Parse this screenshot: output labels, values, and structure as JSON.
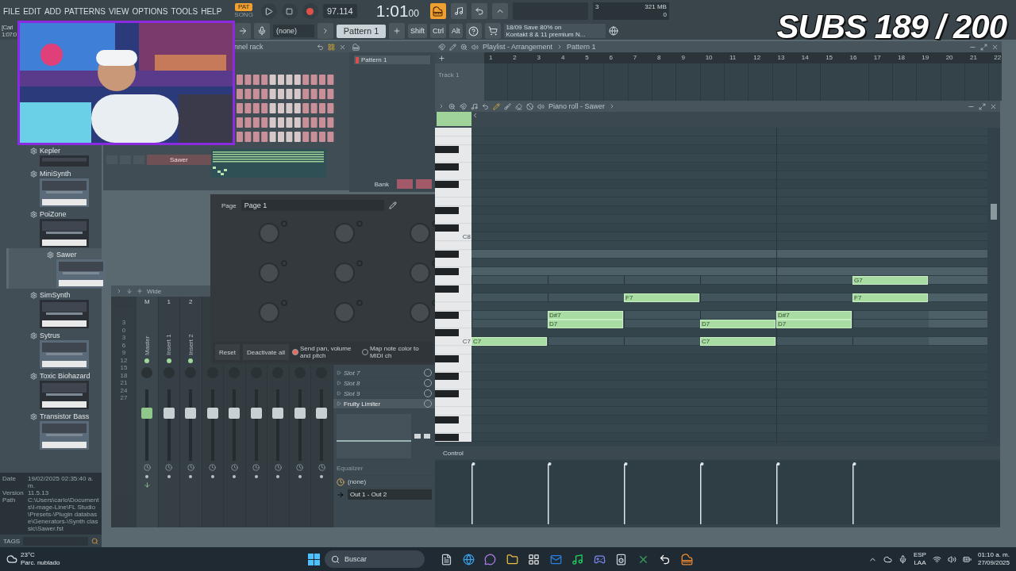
{
  "menu": [
    "FILE",
    "EDIT",
    "ADD",
    "PATTERNS",
    "VIEW",
    "OPTIONS",
    "TOOLS",
    "HELP"
  ],
  "transport": {
    "modes": [
      {
        "label": "PAT",
        "selected": true
      },
      {
        "label": "SONG",
        "selected": false
      }
    ],
    "tempo": "97.114",
    "time": "1:01",
    "time_small": "00"
  },
  "monitor": {
    "cpu": "3",
    "memory": "321 MB",
    "polyphony": "0"
  },
  "overlay": {
    "subs": "SUBS 189 / 200"
  },
  "hint_left": {
    "line1": "[Carl",
    "line2": "1:07:0"
  },
  "toolbar": {
    "snap": "(none)",
    "pattern": "Pattern 1",
    "modifiers": [
      "Shift",
      "Ctrl",
      "Alt"
    ],
    "news_date": "18/09",
    "news_line1": "Save 80% on",
    "news_line2": "Kontakt 8 & 11 premium N..."
  },
  "browser": {
    "items": [
      {
        "name": "Kepler",
        "selected": false
      },
      {
        "name": "MiniSynth",
        "selected": false
      },
      {
        "name": "PoiZone",
        "selected": false
      },
      {
        "name": "Sawer",
        "selected": true
      },
      {
        "name": "SimSynth",
        "selected": false
      },
      {
        "name": "Sytrus",
        "selected": false
      },
      {
        "name": "Toxic Biohazard",
        "selected": false
      },
      {
        "name": "Transistor Bass",
        "selected": false
      }
    ],
    "info": [
      {
        "label": "Date",
        "value": "19/02/2025 02:35:40 a. m."
      },
      {
        "label": "Version",
        "value": "11.5.13"
      },
      {
        "label": "Path",
        "value": "C:\\Users\\carlo\\Documents\\I-mage-Line\\FL Studio\\Presets-\\Plugin database\\Generators-\\Synth classic\\Sawer.fst"
      }
    ],
    "tags": "TAGS"
  },
  "channel_rack": {
    "title": "nnel rack",
    "channel": "Sawer"
  },
  "pattern_picker": {
    "patterns": [
      "Pattern 1"
    ],
    "bank": "Bank"
  },
  "controller": {
    "page_label": "Page",
    "page": "Page 1",
    "buttons": [
      "Reset",
      "Deactivate all"
    ],
    "options": [
      {
        "label": "Send pan, volume and pitch",
        "checked": true
      },
      {
        "label": "Map note color to MIDI ch",
        "checked": false
      }
    ]
  },
  "mixer": {
    "toolbar_label": "Wide",
    "meter_scale": [
      "3",
      "0",
      "3",
      "6",
      "9",
      "12",
      "15",
      "18",
      "21",
      "24",
      "27"
    ],
    "strips": [
      {
        "kind": "master",
        "header": "M",
        "label": "Master",
        "level": 0.7
      },
      {
        "kind": "insert",
        "header": "1",
        "label": "Insert 1",
        "level": 0.7
      },
      {
        "kind": "insert",
        "header": "2",
        "label": "Insert 2",
        "level": 0.7
      },
      {
        "kind": "insert",
        "level": 0.7
      },
      {
        "kind": "insert",
        "level": 0.7
      },
      {
        "kind": "insert",
        "level": 0.7
      },
      {
        "kind": "insert",
        "level": 0.7
      },
      {
        "kind": "insert",
        "level": 0.7
      },
      {
        "kind": "insert",
        "level": 0.7
      }
    ]
  },
  "mixer_slots": {
    "slots": [
      {
        "name": "Slot 7",
        "active": false
      },
      {
        "name": "Slot 8",
        "active": false
      },
      {
        "name": "Slot 9",
        "active": false
      },
      {
        "name": "Fruity Limiter",
        "active": true
      }
    ],
    "eq_label": "Equalizer",
    "input": "(none)",
    "output": "Out 1 - Out 2"
  },
  "playlist": {
    "title": "Playlist - Arrangement",
    "pattern": "Pattern 1",
    "ruler": [
      "1",
      "2",
      "3",
      "4",
      "5",
      "6",
      "7",
      "8",
      "9",
      "10",
      "11",
      "12",
      "13",
      "14",
      "15",
      "16",
      "17",
      "18",
      "19",
      "20",
      "21",
      "22"
    ],
    "track": "Track 1"
  },
  "piano_roll": {
    "title": "Piano roll - Sawer",
    "key_labels": [
      "C8",
      "C7"
    ],
    "control_label": "Control",
    "rows": [
      {
        "highlighted": false
      },
      {
        "highlighted": false
      },
      {
        "highlighted": false
      },
      {
        "highlighted": false
      },
      {
        "highlighted": false
      },
      {
        "highlighted": false
      },
      {
        "highlighted": false
      },
      {
        "highlighted": false
      },
      {
        "highlighted": false
      },
      {
        "highlighted": false
      },
      {
        "highlighted": false
      },
      {
        "highlighted": false
      },
      {
        "highlighted": false
      },
      {
        "highlighted": false
      },
      {
        "highlighted": true
      },
      {
        "highlighted": false
      },
      {
        "highlighted": true
      },
      {
        "highlighted": true,
        "slots": [
          {
            "filled": false
          },
          {
            "filled": false
          },
          {
            "filled": false
          },
          {
            "filled": false
          },
          {
            "filled": false
          },
          {
            "filled": true,
            "label": "G7"
          }
        ]
      },
      {
        "highlighted": false
      },
      {
        "highlighted": true,
        "slots": [
          {
            "filled": false
          },
          {
            "filled": false
          },
          {
            "filled": true,
            "label": "F7"
          },
          {
            "filled": false
          },
          {
            "filled": false
          },
          {
            "filled": true,
            "label": "F7"
          }
        ]
      },
      {
        "highlighted": false
      },
      {
        "highlighted": true,
        "slots": [
          {
            "filled": false
          },
          {
            "filled": true,
            "label": "D#7"
          },
          {
            "filled": false
          },
          {
            "filled": false
          },
          {
            "filled": true,
            "label": "D#7"
          },
          {
            "filled": false
          }
        ]
      },
      {
        "highlighted": true,
        "slots": [
          {
            "filled": false
          },
          {
            "filled": true,
            "label": "D7"
          },
          {
            "filled": false
          },
          {
            "filled": true,
            "label": "D7"
          },
          {
            "filled": true,
            "label": "D7"
          },
          {
            "filled": false
          }
        ]
      },
      {
        "highlighted": false
      },
      {
        "highlighted": true,
        "slots": [
          {
            "filled": true,
            "label": "C7"
          },
          {
            "filled": false
          },
          {
            "filled": false
          },
          {
            "filled": true,
            "label": "C7"
          },
          {
            "filled": false
          },
          {
            "filled": false
          }
        ]
      },
      {
        "highlighted": false
      },
      {
        "highlighted": false
      },
      {
        "highlighted": false
      },
      {
        "highlighted": false
      },
      {
        "highlighted": false
      },
      {
        "highlighted": false
      },
      {
        "highlighted": false
      },
      {
        "highlighted": false
      },
      {
        "highlighted": false
      },
      {
        "highlighted": false
      },
      {
        "highlighted": false
      }
    ]
  },
  "taskbar": {
    "temperature": "23°C",
    "weather": "Parc. nublado",
    "search": "Buscar",
    "language": "ESP",
    "region": "LAA",
    "time": "01:10 a. m.",
    "date": "27/09/2025"
  }
}
